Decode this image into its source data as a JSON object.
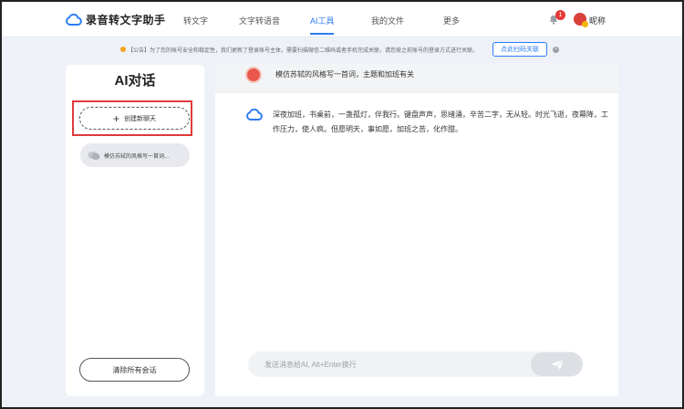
{
  "app": {
    "title": "录音转文字助手",
    "brand_color": "#2d7cf6"
  },
  "nav": {
    "items": [
      {
        "label": "转文字"
      },
      {
        "label": "文字转语音"
      },
      {
        "label": "AI工具",
        "active": true
      },
      {
        "label": "我的文件"
      },
      {
        "label": "更多"
      }
    ]
  },
  "user": {
    "notification_count": "1",
    "nickname": "昵称"
  },
  "notice": {
    "text": "【公告】为了您的账号安全和稳定性，我们更新了登录账号主体，需要扫描微信二维码或者手机完成关联，请您按之前账号的登录方式进行关联。",
    "button_label": "点此扫码关联"
  },
  "sidebar": {
    "title": "AI对话",
    "new_chat_label": "创建新聊天",
    "history": [
      {
        "label": "模仿苏轼的风格写一首词..."
      }
    ],
    "clear_label": "清除所有会话"
  },
  "chat": {
    "question": "模仿苏轼的风格写一首词，主题和加班有关",
    "answer": "深夜加班，书桌前，一盏孤灯，伴我行。键盘声声，思绪涌，辛苦二字，无从轻。时光飞逝，夜幕降，工作压力，使人疯。但愿明天，事如愿，加班之苦，化作甜。",
    "input_placeholder": "发送消息给AI, Alt+Enter换行"
  }
}
